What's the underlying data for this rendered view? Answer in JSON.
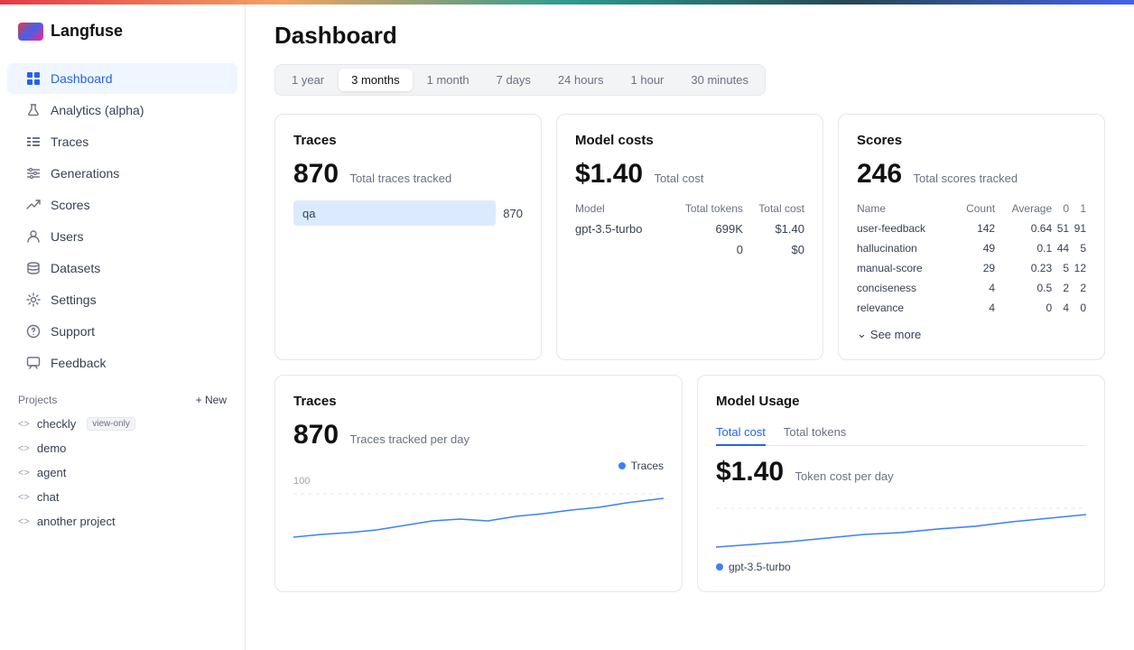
{
  "app": {
    "name": "Langfuse"
  },
  "nav": {
    "items": [
      {
        "id": "dashboard",
        "label": "Dashboard",
        "icon": "grid",
        "active": true
      },
      {
        "id": "analytics",
        "label": "Analytics (alpha)",
        "icon": "flask"
      },
      {
        "id": "traces",
        "label": "Traces",
        "icon": "list"
      },
      {
        "id": "generations",
        "label": "Generations",
        "icon": "sliders"
      },
      {
        "id": "scores",
        "label": "Scores",
        "icon": "trending-up"
      },
      {
        "id": "users",
        "label": "Users",
        "icon": "user"
      },
      {
        "id": "datasets",
        "label": "Datasets",
        "icon": "database"
      },
      {
        "id": "settings",
        "label": "Settings",
        "icon": "gear"
      },
      {
        "id": "support",
        "label": "Support",
        "icon": "help-circle"
      },
      {
        "id": "feedback",
        "label": "Feedback",
        "icon": "message-square"
      }
    ]
  },
  "projects": {
    "header": "Projects",
    "new_label": "+ New",
    "items": [
      {
        "name": "checkly",
        "badge": "view-only"
      },
      {
        "name": "demo",
        "badge": null
      },
      {
        "name": "agent",
        "badge": null
      },
      {
        "name": "chat",
        "badge": null
      },
      {
        "name": "another project",
        "badge": null
      }
    ]
  },
  "page": {
    "title": "Dashboard"
  },
  "time_filters": {
    "options": [
      "1 year",
      "3 months",
      "1 month",
      "7 days",
      "24 hours",
      "1 hour",
      "30 minutes"
    ],
    "active": "3 months"
  },
  "traces_card": {
    "title": "Traces",
    "count": "870",
    "label": "Total traces tracked",
    "bars": [
      {
        "name": "qa",
        "value": 870,
        "width_pct": 100
      }
    ]
  },
  "model_costs_card": {
    "title": "Model costs",
    "total": "$1.40",
    "total_label": "Total cost",
    "columns": [
      "Model",
      "Total tokens",
      "Total cost"
    ],
    "rows": [
      {
        "model": "gpt-3.5-turbo",
        "tokens": "699K",
        "cost": "$1.40"
      },
      {
        "model": "",
        "tokens": "0",
        "cost": "$0"
      }
    ]
  },
  "scores_card": {
    "title": "Scores",
    "count": "246",
    "label": "Total scores tracked",
    "columns": [
      "Name",
      "Count",
      "Average",
      "0",
      "1"
    ],
    "rows": [
      {
        "name": "user-feedback",
        "count": "142",
        "avg": "0.64",
        "c0": "51",
        "c1": "91"
      },
      {
        "name": "hallucination",
        "count": "49",
        "avg": "0.1",
        "c0": "44",
        "c1": "5"
      },
      {
        "name": "manual-score",
        "count": "29",
        "avg": "0.23",
        "c0": "5",
        "c1": "12"
      },
      {
        "name": "conciseness",
        "count": "4",
        "avg": "0.5",
        "c0": "2",
        "c1": "2"
      },
      {
        "name": "relevance",
        "count": "4",
        "avg": "0",
        "c0": "4",
        "c1": "0"
      }
    ],
    "see_more": "See more"
  },
  "traces_chart": {
    "title": "Traces",
    "count": "870",
    "label": "Traces tracked per day",
    "legend": "Traces",
    "y_label": "100"
  },
  "model_usage": {
    "title": "Model Usage",
    "tabs": [
      "Total cost",
      "Total tokens"
    ],
    "active_tab": "Total cost",
    "total": "$1.40",
    "label": "Token cost per day",
    "legend": "gpt-3.5-turbo"
  }
}
